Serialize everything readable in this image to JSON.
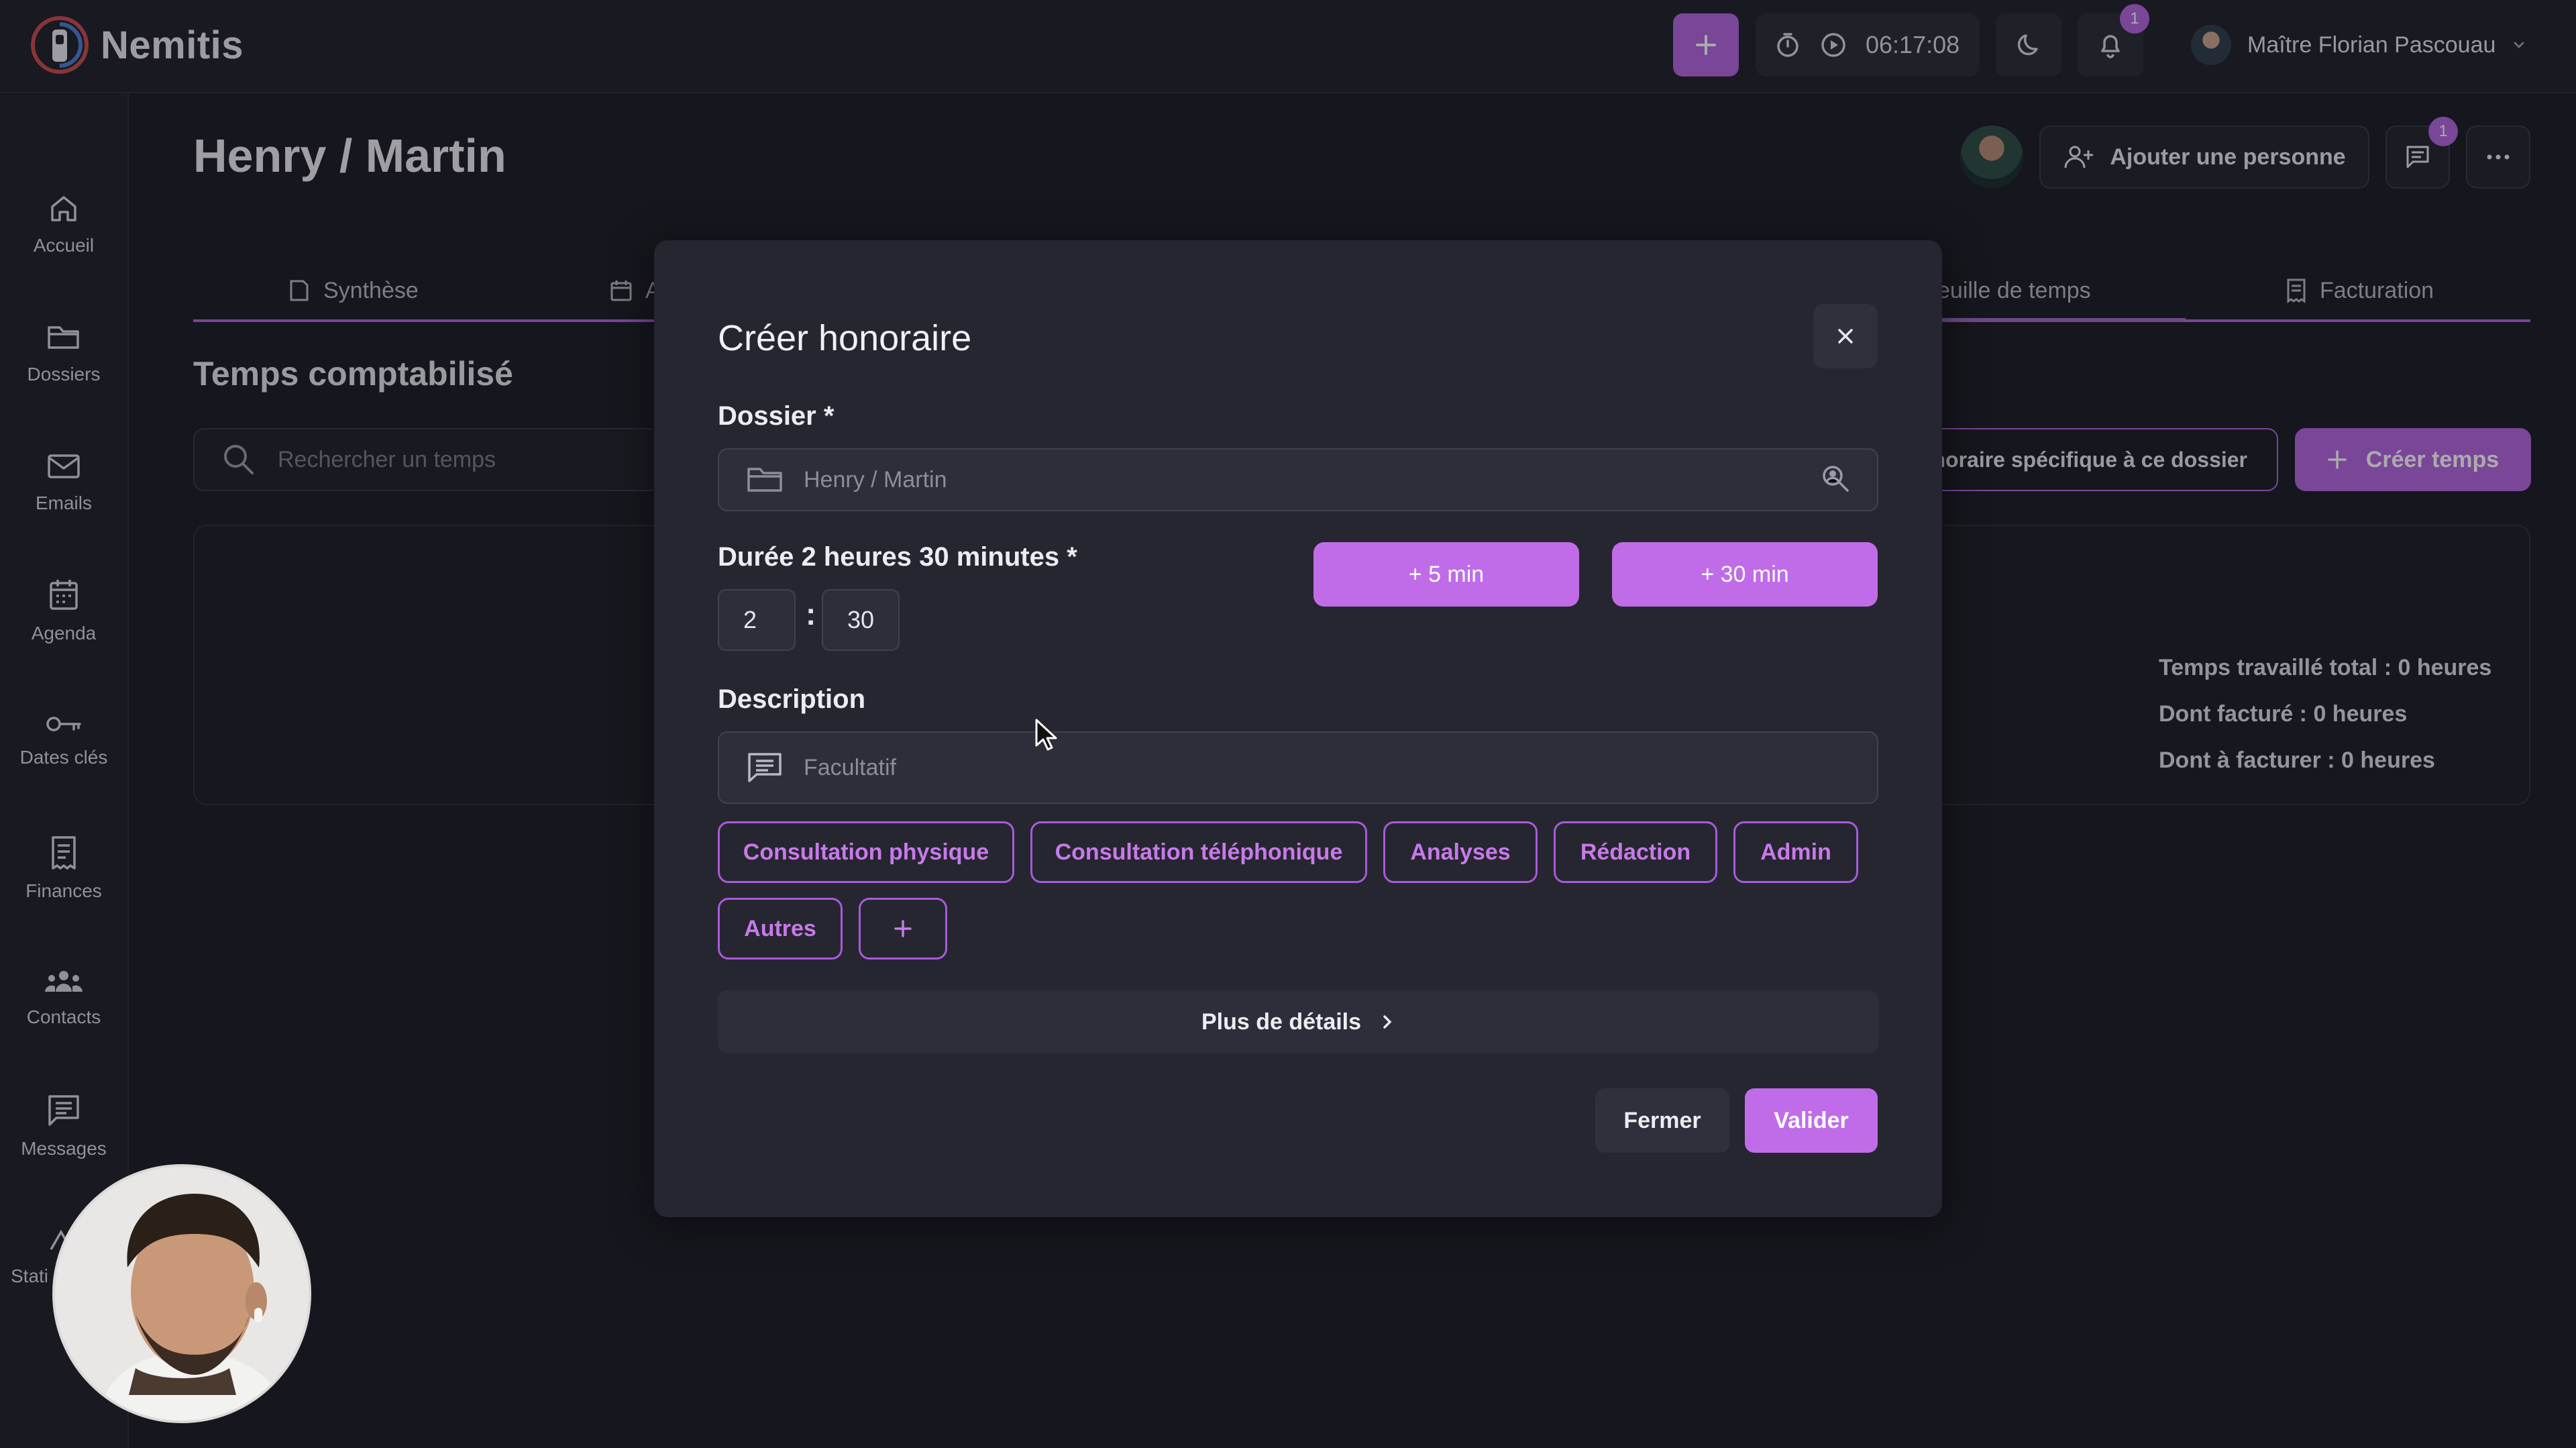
{
  "app": {
    "name": "Nemitis"
  },
  "topbar": {
    "timer": "06:17:08",
    "notifications_count": "1",
    "user_name": "Maître Florian Pascouau"
  },
  "sidebar": {
    "items": [
      {
        "label": "Accueil",
        "icon": "home-icon"
      },
      {
        "label": "Dossiers",
        "icon": "folder-icon"
      },
      {
        "label": "Emails",
        "icon": "mail-icon"
      },
      {
        "label": "Agenda",
        "icon": "calendar-icon"
      },
      {
        "label": "Dates clés",
        "icon": "key-icon"
      },
      {
        "label": "Finances",
        "icon": "receipt-icon"
      },
      {
        "label": "Contacts",
        "icon": "people-icon"
      },
      {
        "label": "Messages",
        "icon": "message-icon"
      },
      {
        "label": "Stati",
        "icon": "stats-icon"
      }
    ]
  },
  "page": {
    "title": "Henry / Martin",
    "add_person_label": "Ajouter une personne",
    "messages_badge": "1",
    "tabs": [
      {
        "label": "Synthèse"
      },
      {
        "label": "A"
      },
      {
        "label": "euille de temps"
      },
      {
        "label": "Facturation"
      }
    ],
    "section_title": "Temps comptabilisé",
    "search_placeholder": "Rechercher un temps",
    "specific_fee_label": "noraire spécifique à ce dossier",
    "create_time_label": "Créer temps",
    "stats": {
      "total": "Temps travaillé total : 0 heures",
      "billed": "Dont facturé : 0 heures",
      "to_bill": "Dont à facturer : 0 heures"
    }
  },
  "modal": {
    "title": "Créer honoraire",
    "dossier_label": "Dossier *",
    "dossier_value": "Henry / Martin",
    "duration_label": "Durée 2 heures 30 minutes *",
    "hours": "2",
    "minutes": "30",
    "add_5": "+ 5 min",
    "add_30": "+ 30 min",
    "description_label": "Description",
    "description_placeholder": "Facultatif",
    "chips": [
      "Consultation physique",
      "Consultation téléphonique",
      "Analyses",
      "Rédaction",
      "Admin",
      "Autres"
    ],
    "more_details": "Plus de détails",
    "close_label": "Fermer",
    "submit_label": "Valider"
  },
  "colors": {
    "accent": "#b365df",
    "accent_bright": "#c06ce8",
    "background": "#1b1b24",
    "modal": "#262631"
  }
}
